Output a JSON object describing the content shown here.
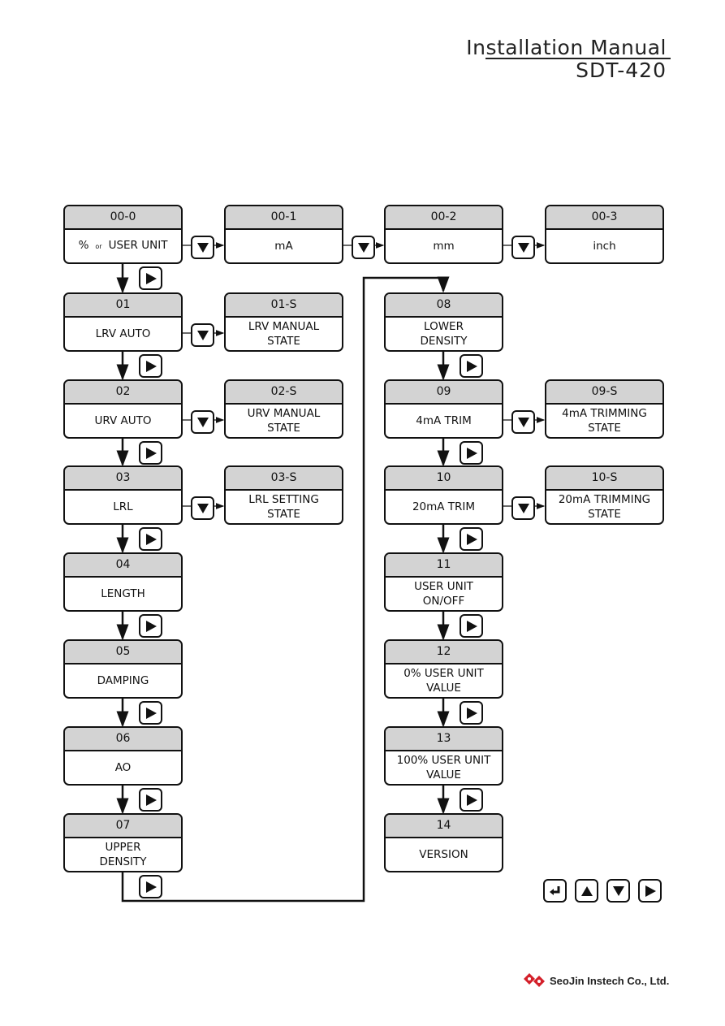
{
  "header": {
    "title": "Installation Manual",
    "model": "SDT-420"
  },
  "boxes": [
    {
      "id": "00-0",
      "lines": [
        "%",
        "or",
        "USER UNIT"
      ]
    },
    {
      "id": "00-1",
      "lines": [
        "mA"
      ]
    },
    {
      "id": "00-2",
      "lines": [
        "mm"
      ]
    },
    {
      "id": "00-3",
      "lines": [
        "inch"
      ]
    },
    {
      "id": "01",
      "lines": [
        "LRV AUTO"
      ]
    },
    {
      "id": "01-S",
      "lines": [
        "LRV MANUAL",
        "STATE"
      ]
    },
    {
      "id": "02",
      "lines": [
        "URV AUTO"
      ]
    },
    {
      "id": "02-S",
      "lines": [
        "URV MANUAL",
        "STATE"
      ]
    },
    {
      "id": "03",
      "lines": [
        "LRL"
      ]
    },
    {
      "id": "03-S",
      "lines": [
        "LRL SETTING",
        "STATE"
      ]
    },
    {
      "id": "04",
      "lines": [
        "LENGTH"
      ]
    },
    {
      "id": "05",
      "lines": [
        "DAMPING"
      ]
    },
    {
      "id": "06",
      "lines": [
        "AO"
      ]
    },
    {
      "id": "07",
      "lines": [
        "UPPER",
        "DENSITY"
      ]
    },
    {
      "id": "08",
      "lines": [
        "LOWER",
        "DENSITY"
      ]
    },
    {
      "id": "09",
      "lines": [
        "4mA TRIM"
      ]
    },
    {
      "id": "09-S",
      "lines": [
        "4mA TRIMMING",
        "STATE"
      ]
    },
    {
      "id": "10",
      "lines": [
        "20mA TRIM"
      ]
    },
    {
      "id": "10-S",
      "lines": [
        "20mA TRIMMING",
        "STATE"
      ]
    },
    {
      "id": "11",
      "lines": [
        "USER UNIT",
        "ON/OFF"
      ]
    },
    {
      "id": "12",
      "lines": [
        "0% USER UNIT",
        "VALUE"
      ]
    },
    {
      "id": "13",
      "lines": [
        "100% USER UNIT",
        "VALUE"
      ]
    },
    {
      "id": "14",
      "lines": [
        "VERSION"
      ]
    }
  ],
  "legend_keys": [
    "enter-icon",
    "up-arrow-icon",
    "down-arrow-icon",
    "right-arrow-icon"
  ],
  "logo": {
    "text": "SeoJin Instech Co., Ltd.",
    "color": "#d4202a"
  }
}
